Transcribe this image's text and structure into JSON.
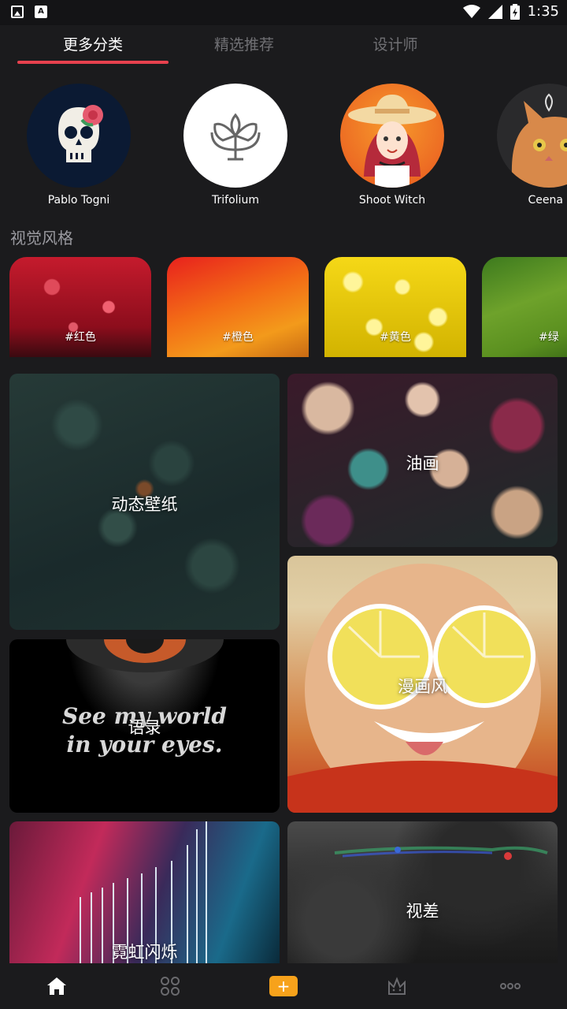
{
  "status_bar": {
    "time": "1:35",
    "left_icons": [
      "image-icon",
      "font-icon"
    ],
    "right_icons": [
      "wifi-icon",
      "signal-icon",
      "battery-icon"
    ]
  },
  "tabs": [
    {
      "label": "更多分类",
      "active": true
    },
    {
      "label": "精选推荐",
      "active": false
    },
    {
      "label": "设计师",
      "active": false
    }
  ],
  "colors": {
    "accent": "#e8414e",
    "background": "#1b1b1d",
    "tab_inactive": "#707074",
    "add_button": "#f7a21b"
  },
  "designers": [
    {
      "name": "Pablo Togni",
      "icon": "skull-icon"
    },
    {
      "name": "Trifolium",
      "icon": "lotus-icon"
    },
    {
      "name": "Shoot Witch",
      "icon": "girl-avatar-icon"
    },
    {
      "name": "Ceena I",
      "icon": "cat-avatar-icon"
    }
  ],
  "visual_style": {
    "title": "视觉风格",
    "items": [
      {
        "label": "#红色"
      },
      {
        "label": "#橙色"
      },
      {
        "label": "#黄色"
      },
      {
        "label": "#绿"
      }
    ]
  },
  "categories": [
    {
      "label": "动态壁纸"
    },
    {
      "label": "油画"
    },
    {
      "label": "漫画风"
    },
    {
      "label": "语录",
      "image_text_line1": "See my world",
      "image_text_line2": "in your eyes."
    },
    {
      "label": "霓虹闪烁"
    },
    {
      "label": "视差"
    }
  ],
  "bottom_nav": [
    {
      "icon": "home-icon",
      "active": true
    },
    {
      "icon": "grid-icon",
      "active": false
    },
    {
      "icon": "add-icon",
      "label": "+",
      "active": false
    },
    {
      "icon": "crown-icon",
      "active": false
    },
    {
      "icon": "more-icon",
      "active": false
    }
  ]
}
